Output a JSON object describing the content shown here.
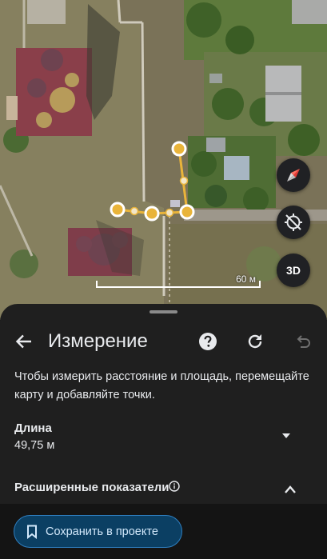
{
  "map": {
    "scale_label": "60 м",
    "threed_label": "3D",
    "route_color": "#e9b43a",
    "icons": [
      "compass-icon",
      "orientation-icon"
    ]
  },
  "panel": {
    "title": "Измерение",
    "instructions": "Чтобы измерить расстояние и площадь, перемещайте карту и добавляйте точки.",
    "length_label": "Длина",
    "length_value": "49,75 м",
    "advanced_label": "Расширенные показатели",
    "save_label": "Сохранить в проекте",
    "accent": "#2f7fc0"
  }
}
